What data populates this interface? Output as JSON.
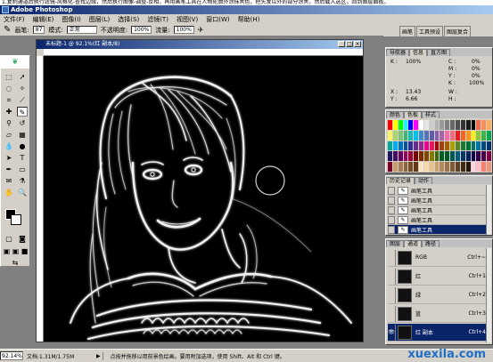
{
  "caption_text": "1.复制通道后执行滤镜-风格化-查找边缘，然后执行图像-调整-反相，再用画笔工具在人物轮廓外涂抹黑色，把头发以外的部分涂黑，然后载入选区，回到图层面板。",
  "app_title": "Adobe Photoshop",
  "menu": [
    "文件(F)",
    "编辑(E)",
    "图像(I)",
    "图层(L)",
    "选择(S)",
    "滤镜(T)",
    "视图(V)",
    "窗口(W)",
    "帮助(H)"
  ],
  "options": {
    "brush_label": "画笔:",
    "brush_size": "87",
    "mode_label": "模式:",
    "mode_value": "正常",
    "opacity_label": "不透明度:",
    "opacity_value": "100%",
    "flow_label": "流量:",
    "flow_value": "100%"
  },
  "well_tabs": [
    "画笔",
    "工具预设",
    "图层复合"
  ],
  "document": {
    "title": "未标题-1 @ 92.1%(红 副本/8)"
  },
  "status": {
    "zoom": "92.14%",
    "doc_size": "文档:1.31M/1.75M",
    "hint": "点按并拖移以用前景色绘画。要用附加选项，使用 Shift、Alt 和 Ctrl 键。"
  },
  "watermark": "xuexila.com",
  "info_panel": {
    "tabs": [
      "导航器",
      "信息",
      "直方图"
    ],
    "k_left_label": "K :",
    "k_left_value": "100%",
    "cmyk": [
      {
        "label": "C :",
        "value": "0%"
      },
      {
        "label": "M :",
        "value": "0%"
      },
      {
        "label": "Y :",
        "value": "0%"
      },
      {
        "label": "K :",
        "value": "100%"
      }
    ],
    "x_label": "X :",
    "x_value": "13.43",
    "y_label": "Y :",
    "y_value": "6.66",
    "w_label": "W :",
    "h_label": "H :"
  },
  "color_panel": {
    "tabs": [
      "颜色",
      "色板",
      "样式"
    ],
    "swatches": [
      "#ff0000",
      "#ffff00",
      "#00ff00",
      "#00ffff",
      "#0000ff",
      "#ff00ff",
      "#ffffff",
      "#e6e6e6",
      "#cccccc",
      "#b3b3b3",
      "#999999",
      "#808080",
      "#666666",
      "#4d4d4d",
      "#333333",
      "#1a1a1a",
      "#000000",
      "#f26c4f",
      "#f68e55",
      "#fbaf5c",
      "#fff467",
      "#acd372",
      "#7cc576",
      "#3bb878",
      "#1abbb4",
      "#00bff3",
      "#438ccb",
      "#5574b9",
      "#605ca8",
      "#855fa8",
      "#a763a8",
      "#f06ea9",
      "#f26d7d",
      "#ed1c24",
      "#f26522",
      "#f7941d",
      "#fff200",
      "#8dc63f",
      "#39b54a",
      "#00a651",
      "#00a99d",
      "#00aeef",
      "#0072bc",
      "#0054a6",
      "#2e3192",
      "#662d91",
      "#92278f",
      "#ec008c",
      "#ed145b",
      "#9e0b0f",
      "#a0410d",
      "#a3620a",
      "#aba000",
      "#598527",
      "#1a7b30",
      "#007236",
      "#00746b",
      "#0076a3",
      "#004a80",
      "#003471",
      "#1b1464",
      "#440e62",
      "#630460",
      "#9e005d",
      "#9e0039",
      "#790000",
      "#7b2e00",
      "#7d4900",
      "#827b00",
      "#406618",
      "#005e20",
      "#005826",
      "#005952",
      "#005b7f",
      "#003663",
      "#002157",
      "#0d004c",
      "#32004b",
      "#4b0049",
      "#7b0046",
      "#7a0026",
      "#c69c6d",
      "#a67c52",
      "#8c6239",
      "#754c24",
      "#603913",
      "#fde4c8",
      "#f9d9a7",
      "#e8c28e",
      "#c7a16e",
      "#b48a5c",
      "#9b7249",
      "#7e5a38",
      "#5e4027",
      "#3f2a18",
      "#251709",
      "#ffd5e5",
      "#ffc0cb",
      "#fa8072",
      "#e9967a"
    ]
  },
  "history_panel": {
    "tabs": [
      "历史记录",
      "动作"
    ],
    "items": [
      "画笔工具",
      "画笔工具",
      "画笔工具",
      "画笔工具",
      "画笔工具"
    ]
  },
  "channels_panel": {
    "tabs": [
      "图层",
      "通道",
      "路径"
    ],
    "items": [
      {
        "name": "RGB",
        "key": "Ctrl+~"
      },
      {
        "name": "红",
        "key": "Ctrl+1"
      },
      {
        "name": "绿",
        "key": "Ctrl+2"
      },
      {
        "name": "蓝",
        "key": "Ctrl+3"
      },
      {
        "name": "红 副本",
        "key": "Ctrl+4"
      }
    ]
  },
  "colors": {
    "titlebar": "#0a246a",
    "selection": "#0a246a",
    "chrome": "#d4d0c8",
    "canvas": "#000000",
    "watermark": "#1f6fc8"
  }
}
